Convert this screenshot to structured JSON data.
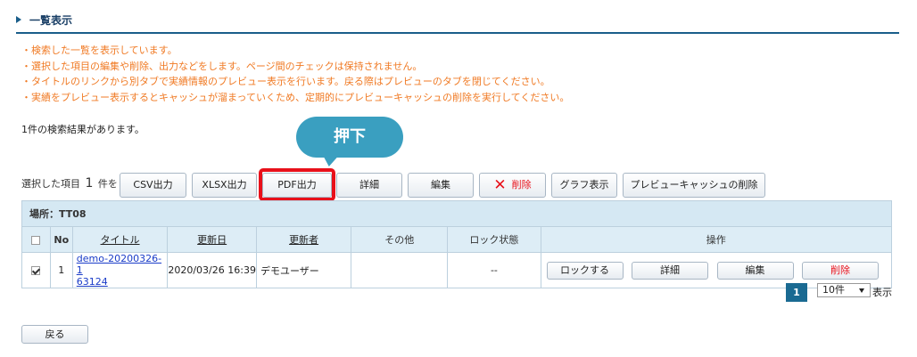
{
  "section": {
    "title": "一覧表示"
  },
  "notes": [
    "・検索した一覧を表示しています。",
    "・選択した項目の編集や削除、出力などをします。ページ間のチェックは保持されません。",
    "・タイトルのリンクから別タブで実績情報のプレビュー表示を行います。戻る際はプレビューのタブを閉じてください。",
    "・実績をプレビュー表示するとキャッシュが溜まっていくため、定期的にプレビューキャッシュの削除を実行してください。"
  ],
  "result_count": "1件の検索結果があります。",
  "callout": "押下",
  "selection": {
    "prefix": "選択した項目",
    "count": "1",
    "suffix": "件を"
  },
  "toolbar": {
    "csv": "CSV出力",
    "xlsx": "XLSX出力",
    "pdf": "PDF出力",
    "detail": "詳細",
    "edit": "編集",
    "delete": "削除",
    "graph": "グラフ表示",
    "preview_cache": "プレビューキャッシュの削除"
  },
  "table": {
    "location": "場所：TT08",
    "headers": {
      "no": "No",
      "title": "タイトル",
      "updated": "更新日",
      "updater": "更新者",
      "other": "その他",
      "lock": "ロック状態",
      "ops": "操作"
    },
    "rows": [
      {
        "checked": true,
        "no": "1",
        "title_line1": "demo-20200326-1",
        "title_line2": "63124",
        "updated": "2020/03/26 16:39",
        "updater": "デモユーザー",
        "other": "",
        "lock": "--",
        "ops": {
          "lock": "ロックする",
          "detail": "詳細",
          "edit": "編集",
          "delete": "削除"
        }
      }
    ]
  },
  "pager": {
    "current": "1",
    "page_size": "10件",
    "suffix": "表示"
  },
  "back": "戻る",
  "colors": {
    "accent": "#1a5e8a",
    "note": "#f07a24",
    "highlight": "#e8101a",
    "callout": "#3a9fc0"
  }
}
